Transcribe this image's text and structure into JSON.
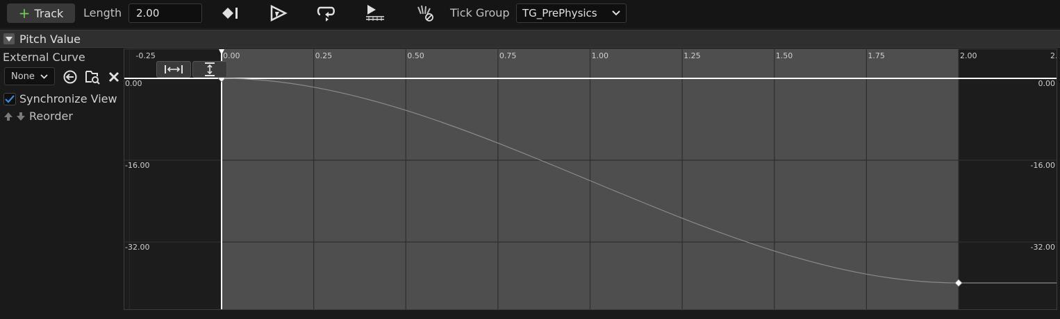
{
  "toolbar": {
    "add_track_label": "Track",
    "length_label": "Length",
    "length_value": "2.00",
    "tick_group_label": "Tick Group",
    "tick_group_value": "TG_PrePhysics",
    "icons": [
      "add-key-icon",
      "autoplay-icon",
      "loop-icon",
      "replicated-icon",
      "ignore-time-dilation-icon"
    ]
  },
  "track": {
    "title": "Pitch Value",
    "external_curve_label": "External Curve",
    "external_curve_value": "None",
    "synchronize_view_label": "Synchronize View",
    "synchronize_view_checked": true,
    "reorder_label": "Reorder"
  },
  "graph": {
    "time_ticks": [
      "-0.25",
      "0.00",
      "0.25",
      "0.50",
      "0.75",
      "1.00",
      "1.25",
      "1.50",
      "1.75",
      "2.00",
      "2."
    ],
    "value_labels_left": [
      "0.00",
      "-16.00",
      "-32.00"
    ],
    "value_labels_right": [
      "0.00",
      "-16.00",
      "-32.00"
    ],
    "active_range": [
      0.0,
      2.0
    ],
    "keys": [
      {
        "time": 0.0,
        "value": 0.0
      },
      {
        "time": 2.0,
        "value": -40.0
      }
    ],
    "colors": {
      "active_bg": "#4e4e4e",
      "inactive_bg": "#1c1c1c",
      "curve": "#8a8a8a",
      "playhead": "#ffffff"
    }
  }
}
